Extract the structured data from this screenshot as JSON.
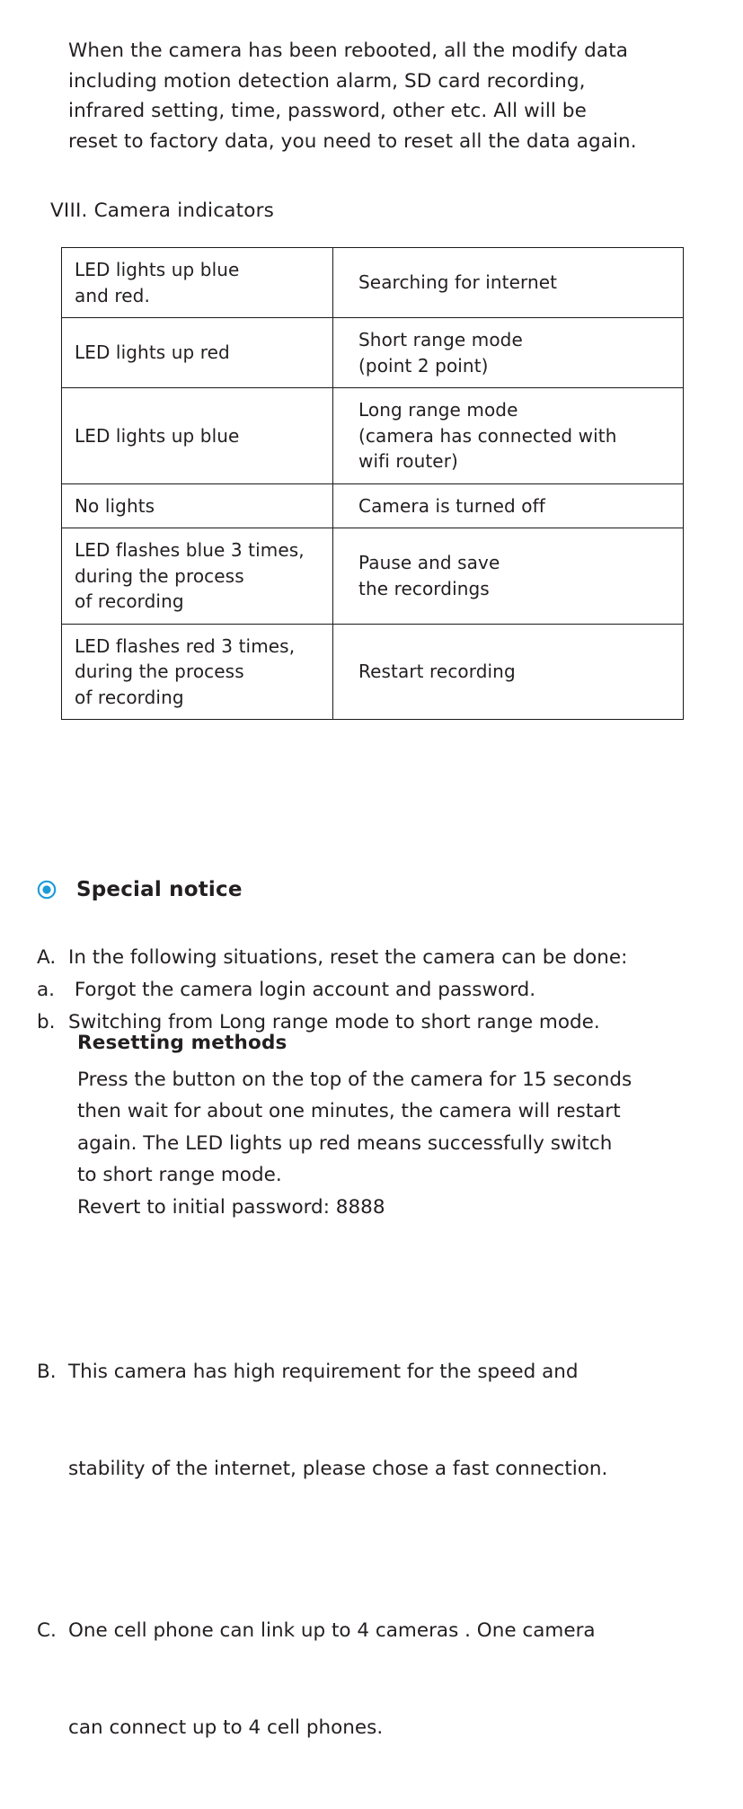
{
  "intro_paragraph": {
    "lines": [
      "When the camera has been rebooted, all the modify data",
      "including motion detection alarm, SD card recording,",
      "infrared setting, time, password, other etc. All will be",
      "reset to factory data, you need to reset all the data again."
    ]
  },
  "section": {
    "heading": "ⅤIII. Camera indicators"
  },
  "indicator_table": {
    "rows": [
      {
        "state": [
          "LED lights up blue",
          "and red."
        ],
        "meaning": [
          "Searching for internet"
        ]
      },
      {
        "state": [
          "LED lights up red"
        ],
        "meaning": [
          "Short range mode",
          "(point 2 point)"
        ]
      },
      {
        "state": [
          "LED lights up blue"
        ],
        "meaning": [
          "Long range mode",
          "(camera has connected with",
          "wifi router)"
        ]
      },
      {
        "state": [
          "No lights"
        ],
        "meaning": [
          "Camera is turned off"
        ]
      },
      {
        "state": [
          "LED flashes blue 3 times,",
          "during the process",
          "of recording"
        ],
        "meaning": [
          "Pause and save",
          "the recordings"
        ]
      },
      {
        "state": [
          "LED flashes red 3 times,",
          "during the process",
          "of recording"
        ],
        "meaning": [
          "Restart recording"
        ]
      }
    ]
  },
  "special_notice": {
    "icon": "radio-dot-icon",
    "title": "Special notice",
    "accent_color": "#1b9bd8"
  },
  "notice_list_top": [
    {
      "marker": "A.",
      "text": "In the following situations, reset the camera can be done:"
    },
    {
      "marker": "a.",
      "text": " Forgot the camera login account and password."
    },
    {
      "marker": "b.",
      "text": "Switching from Long range mode to short range mode."
    }
  ],
  "resetting_methods": {
    "heading": "Resetting methods",
    "lines": [
      "Press the button on the top of the camera for 15 seconds",
      "then wait for about one minutes, the camera will restart",
      "again. The LED lights up red means successfully switch",
      "to short range mode.",
      "Revert to initial password: 8888"
    ]
  },
  "notice_list_bottom": [
    {
      "marker": "B.",
      "lines": [
        "This camera has high requirement for the speed and",
        "stability of the internet, please chose a fast connection."
      ]
    },
    {
      "marker": "C.",
      "lines": [
        "One cell phone can link up to 4 cameras . One camera",
        "can connect up to 4 cell phones."
      ]
    }
  ]
}
